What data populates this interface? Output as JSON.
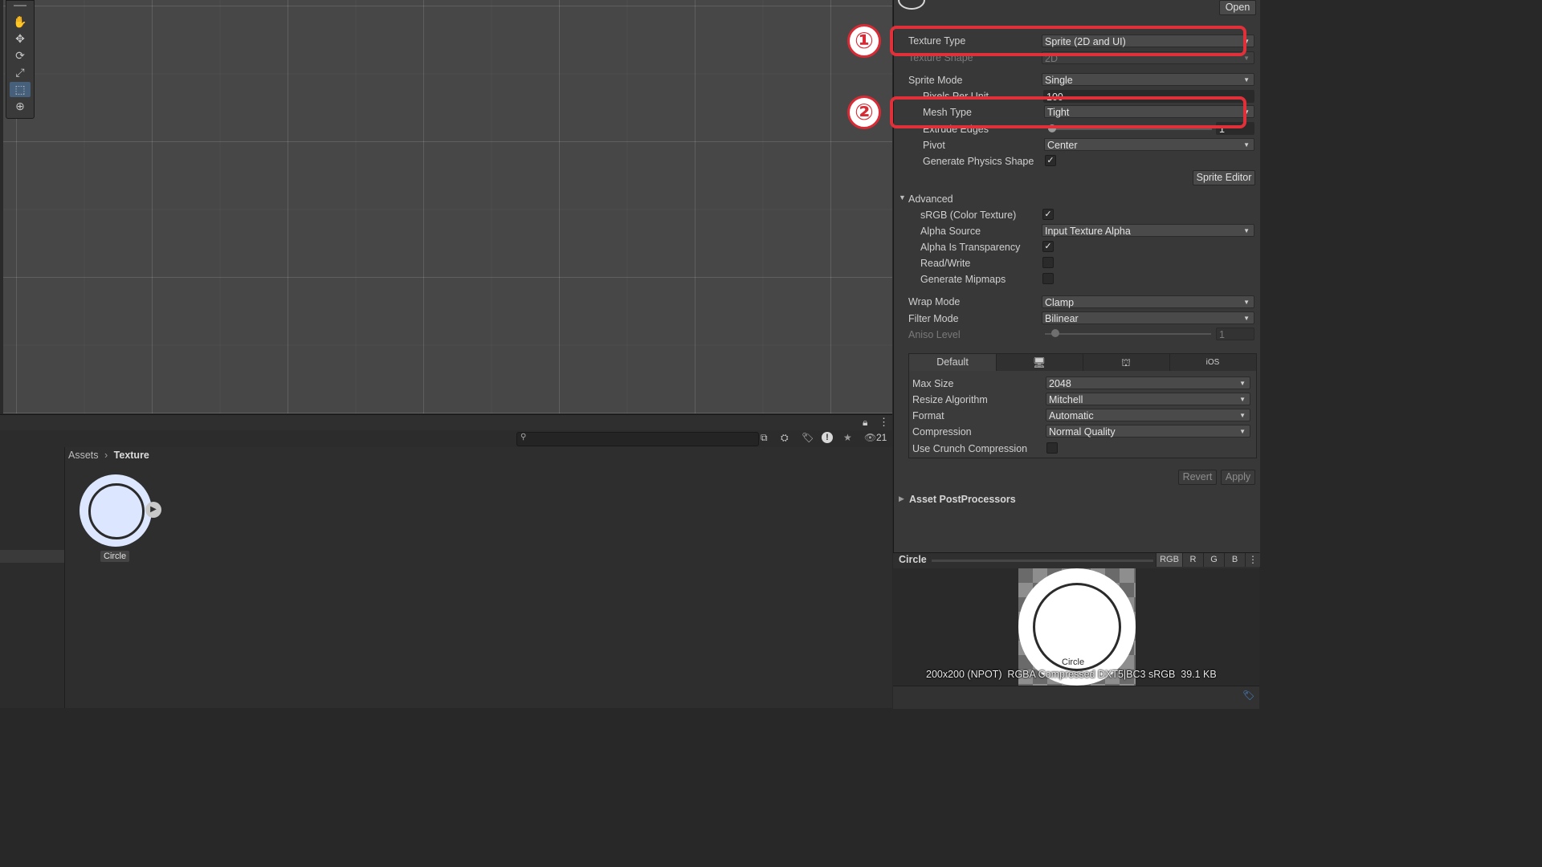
{
  "inspector": {
    "open_button": "Open",
    "texture_type": {
      "label": "Texture Type",
      "value": "Sprite (2D and UI)"
    },
    "texture_shape": {
      "label": "Texture Shape",
      "value": "2D"
    },
    "sprite_mode": {
      "label": "Sprite Mode",
      "value": "Single"
    },
    "pixels_per_unit": {
      "label": "Pixels Per Unit",
      "value": "100"
    },
    "mesh_type": {
      "label": "Mesh Type",
      "value": "Tight"
    },
    "extrude_edges": {
      "label": "Extrude Edges",
      "value": "1"
    },
    "pivot": {
      "label": "Pivot",
      "value": "Center"
    },
    "generate_physics_shape": {
      "label": "Generate Physics Shape",
      "checked": true
    },
    "sprite_editor_button": "Sprite Editor",
    "advanced": {
      "label": "Advanced",
      "srgb": {
        "label": "sRGB (Color Texture)",
        "checked": true
      },
      "alpha_source": {
        "label": "Alpha Source",
        "value": "Input Texture Alpha"
      },
      "alpha_is_transparency": {
        "label": "Alpha Is Transparency",
        "checked": true
      },
      "read_write": {
        "label": "Read/Write",
        "checked": false
      },
      "generate_mipmaps": {
        "label": "Generate Mipmaps",
        "checked": false
      }
    },
    "wrap_mode": {
      "label": "Wrap Mode",
      "value": "Clamp"
    },
    "filter_mode": {
      "label": "Filter Mode",
      "value": "Bilinear"
    },
    "aniso_level": {
      "label": "Aniso Level",
      "value": "1"
    },
    "platform_tabs": [
      "Default",
      "",
      "",
      "iOS"
    ],
    "max_size": {
      "label": "Max Size",
      "value": "2048"
    },
    "resize_algorithm": {
      "label": "Resize Algorithm",
      "value": "Mitchell"
    },
    "format": {
      "label": "Format",
      "value": "Automatic"
    },
    "compression": {
      "label": "Compression",
      "value": "Normal Quality"
    },
    "use_crunch": {
      "label": "Use Crunch Compression",
      "checked": false
    },
    "revert_button": "Revert",
    "apply_button": "Apply",
    "asset_postprocessors": "Asset PostProcessors",
    "markers": [
      "①",
      "②"
    ],
    "highlight_color": "#e0303a"
  },
  "preview": {
    "title": "Circle",
    "channels": [
      "RGB",
      "R",
      "G",
      "B"
    ],
    "image_label": "Circle",
    "info": "200x200 (NPOT)  RGBA Compressed DXT5|BC3 sRGB  39.1 KB"
  },
  "project": {
    "breadcrumb_root": "Assets",
    "breadcrumb_current": "Texture",
    "asset_name": "Circle",
    "hidden_count": "21"
  },
  "scene": {
    "tools": [
      "hand-icon",
      "move-icon",
      "rotate-icon",
      "scale-icon",
      "rect-icon",
      "transform-icon"
    ]
  }
}
